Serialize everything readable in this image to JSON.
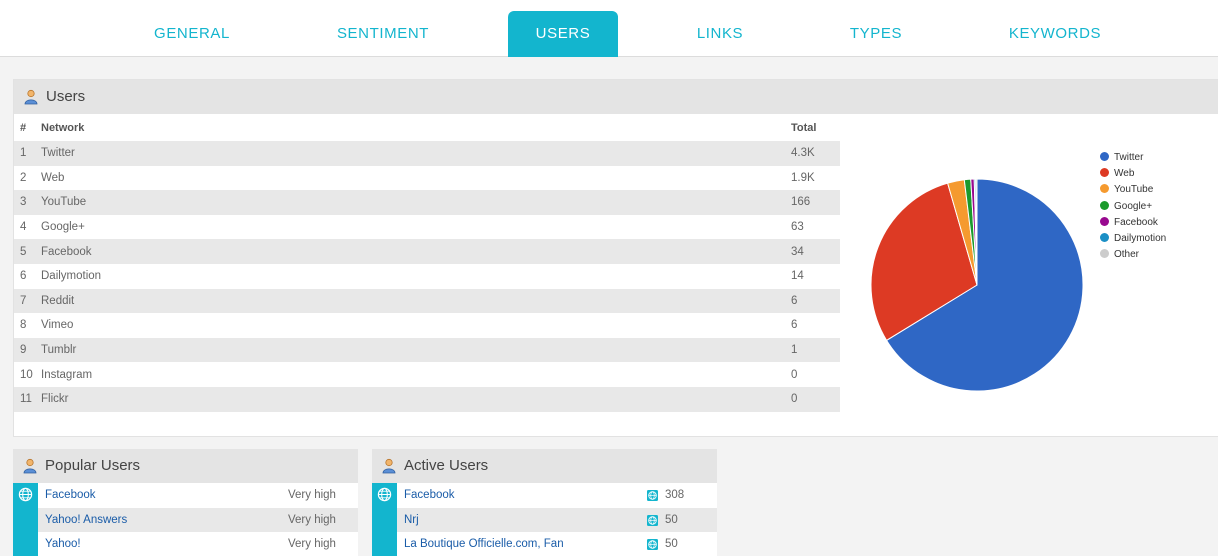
{
  "tabs": [
    {
      "label": "GENERAL"
    },
    {
      "label": "SENTIMENT"
    },
    {
      "label": "USERS"
    },
    {
      "label": "LINKS"
    },
    {
      "label": "TYPES"
    },
    {
      "label": "KEYWORDS"
    }
  ],
  "active_tab": "USERS",
  "users_panel": {
    "title": "Users",
    "columns": {
      "num": "#",
      "network": "Network",
      "total": "Total"
    },
    "rows": [
      {
        "num": "1",
        "network": "Twitter",
        "total": "4.3K"
      },
      {
        "num": "2",
        "network": "Web",
        "total": "1.9K"
      },
      {
        "num": "3",
        "network": "YouTube",
        "total": "166"
      },
      {
        "num": "4",
        "network": "Google+",
        "total": "63"
      },
      {
        "num": "5",
        "network": "Facebook",
        "total": "34"
      },
      {
        "num": "6",
        "network": "Dailymotion",
        "total": "14"
      },
      {
        "num": "7",
        "network": "Reddit",
        "total": "6"
      },
      {
        "num": "8",
        "network": "Vimeo",
        "total": "6"
      },
      {
        "num": "9",
        "network": "Tumblr",
        "total": "1"
      },
      {
        "num": "10",
        "network": "Instagram",
        "total": "0"
      },
      {
        "num": "11",
        "network": "Flickr",
        "total": "0"
      }
    ]
  },
  "chart_data": {
    "type": "pie",
    "categories": [
      "Twitter",
      "Web",
      "YouTube",
      "Google+",
      "Facebook",
      "Dailymotion",
      "Other"
    ],
    "values": [
      4300,
      1900,
      166,
      63,
      34,
      14,
      13
    ],
    "colors": [
      "#2f67c5",
      "#dd3a24",
      "#f59a2f",
      "#1b9a2c",
      "#98098f",
      "#1b8fc5",
      "#cccccc"
    ],
    "title": "",
    "legend": "right"
  },
  "popular_users": {
    "title": "Popular Users",
    "rows": [
      {
        "name": "Facebook",
        "value": "Very high"
      },
      {
        "name": "Yahoo! Answers",
        "value": "Very high"
      },
      {
        "name": "Yahoo!",
        "value": "Very high"
      }
    ]
  },
  "active_users": {
    "title": "Active Users",
    "rows": [
      {
        "name": "Facebook",
        "value": "308"
      },
      {
        "name": "Nrj",
        "value": "50"
      },
      {
        "name": "La Boutique Officielle.com, Fan",
        "value": "50"
      }
    ]
  },
  "colors": {
    "accent": "#13b5ce",
    "link": "#1a5ca8",
    "header_bg": "#e4e4e4"
  }
}
